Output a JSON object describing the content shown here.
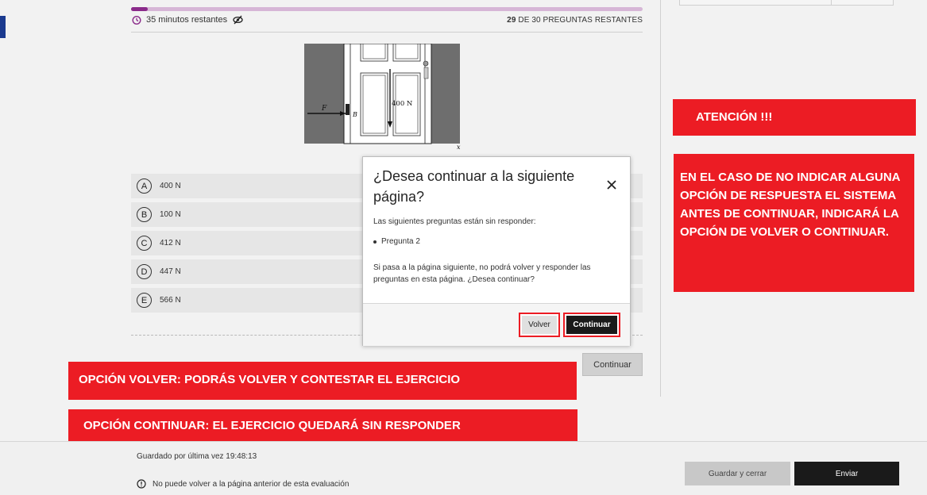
{
  "timer": {
    "text": "35 minutos restantes"
  },
  "progress": {
    "answered": 1,
    "total": 30,
    "fraction": 0.033
  },
  "questions": {
    "remaining_count": "29",
    "remaining_suffix": " DE 30 PREGUNTAS RESTANTES"
  },
  "figure": {
    "force_label": "F",
    "point_label": "B",
    "weight_label": "400 N",
    "axis_label": "x"
  },
  "options": [
    {
      "letter": "A",
      "value": "400 N"
    },
    {
      "letter": "B",
      "value": "100 N"
    },
    {
      "letter": "C",
      "value": "412 N"
    },
    {
      "letter": "D",
      "value": "447 N"
    },
    {
      "letter": "E",
      "value": "566 N"
    }
  ],
  "main_continue_label": "Continuar",
  "footer": {
    "saved_text": "Guardado por última vez 19:48:13",
    "note_text": "No puede volver a la página anterior de esta evaluación",
    "save_close_label": "Guardar y cerrar",
    "submit_label": "Enviar"
  },
  "modal": {
    "title": "¿Desea continuar a la siguiente página?",
    "text1": "Las siguientes preguntas están sin responder:",
    "list_item": "Pregunta 2",
    "text2": "Si pasa a la página siguiente, no podrá volver y responder las preguntas en esta página. ¿Desea continuar?",
    "back_label": "Volver",
    "continue_label": "Continuar"
  },
  "annotations": {
    "attention": "ATENCIÓN !!!",
    "info": "EN EL CASO DE NO INDICAR ALGUNA OPCIÓN DE RESPUESTA EL SISTEMA ANTES DE CONTINUAR, INDICARÁ LA OPCIÓN DE VOLVER O CONTINUAR.",
    "back_option": "OPCIÓN VOLVER: PODRÁS VOLVER Y CONTESTAR EL EJERCICIO",
    "continue_option": "OPCIÓN CONTINUAR: EL EJERCICIO QUEDARÁ SIN RESPONDER"
  },
  "colors": {
    "accent": "#8a2a8a",
    "annotation_red": "#ec1c24",
    "dark_button": "#1a1a1a",
    "left_accent": "#1b3a8f"
  }
}
